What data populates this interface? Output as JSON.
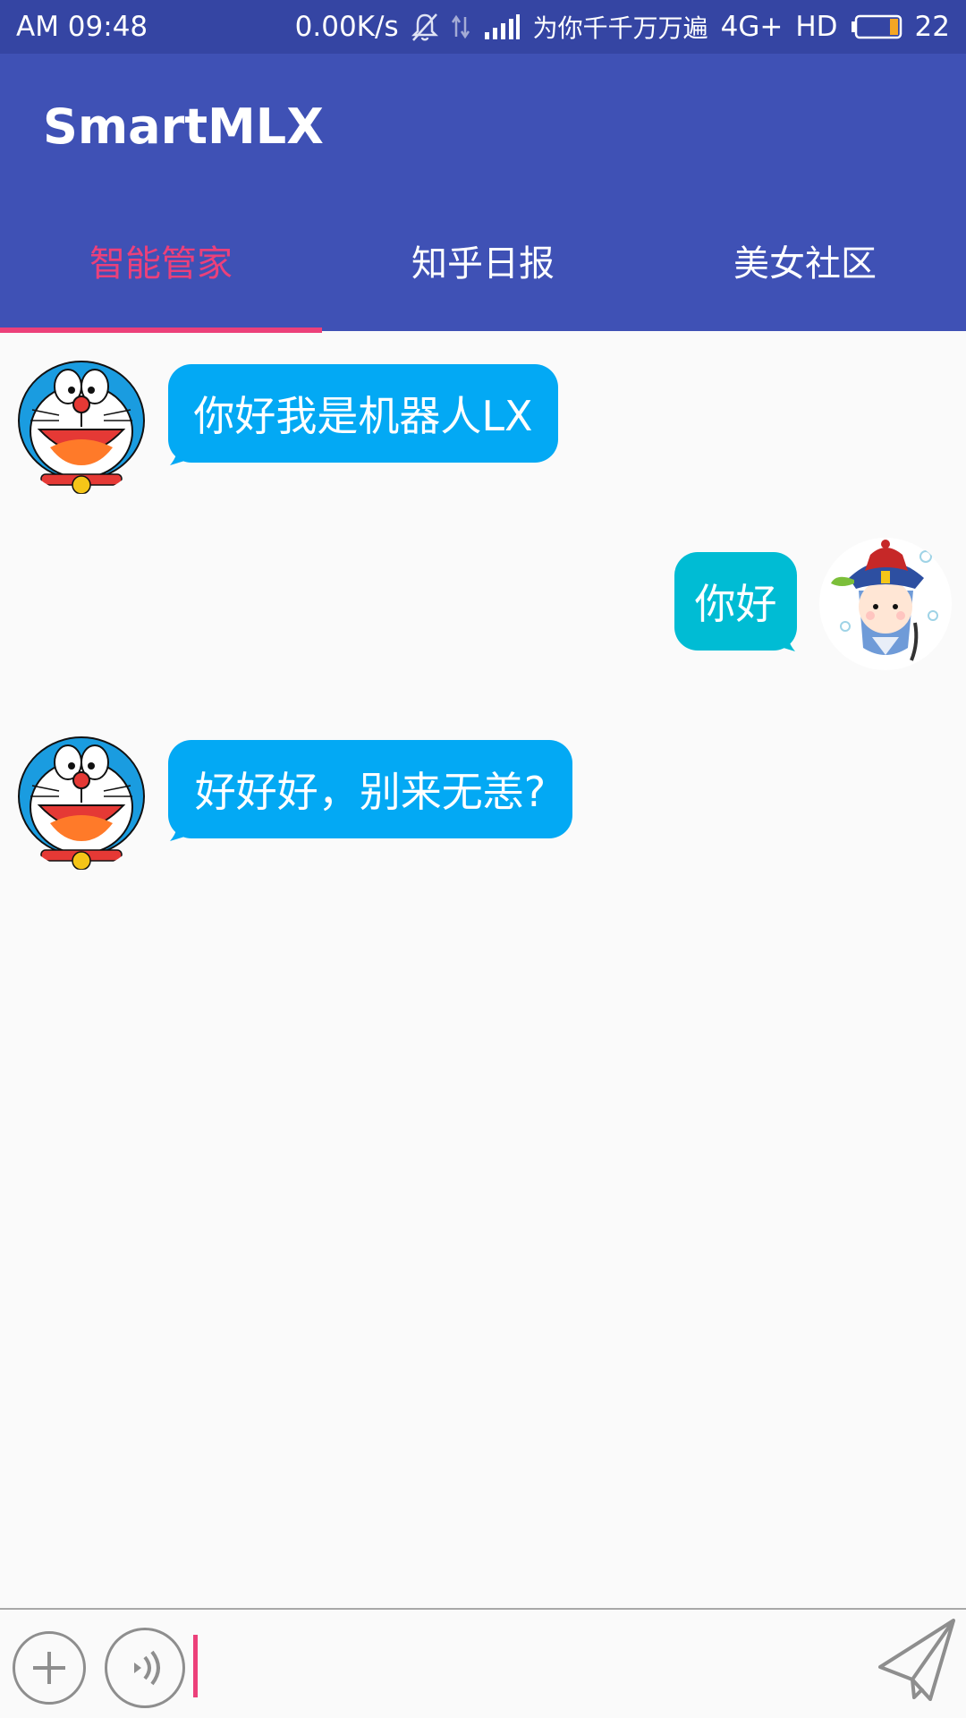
{
  "status_bar": {
    "time": "AM  09:48",
    "speed": "0.00K/s",
    "carrier": "为你千千万万遍",
    "network": "4G+",
    "hd": "HD",
    "battery_level": "22"
  },
  "app": {
    "title": "SmartMLX"
  },
  "tabs": [
    {
      "label": "智能管家",
      "active": true
    },
    {
      "label": "知乎日报",
      "active": false
    },
    {
      "label": "美女社区",
      "active": false
    }
  ],
  "messages": [
    {
      "side": "left",
      "text": "你好我是机器人LX"
    },
    {
      "side": "right",
      "text": "你好"
    },
    {
      "side": "left",
      "text": "好好好，别来无恙?"
    }
  ],
  "colors": {
    "accent": "#ec407a",
    "primary": "#3f51b5",
    "primary_dark": "#3545a3",
    "bubble_left": "#03a9f4",
    "bubble_right": "#00bcd4"
  }
}
